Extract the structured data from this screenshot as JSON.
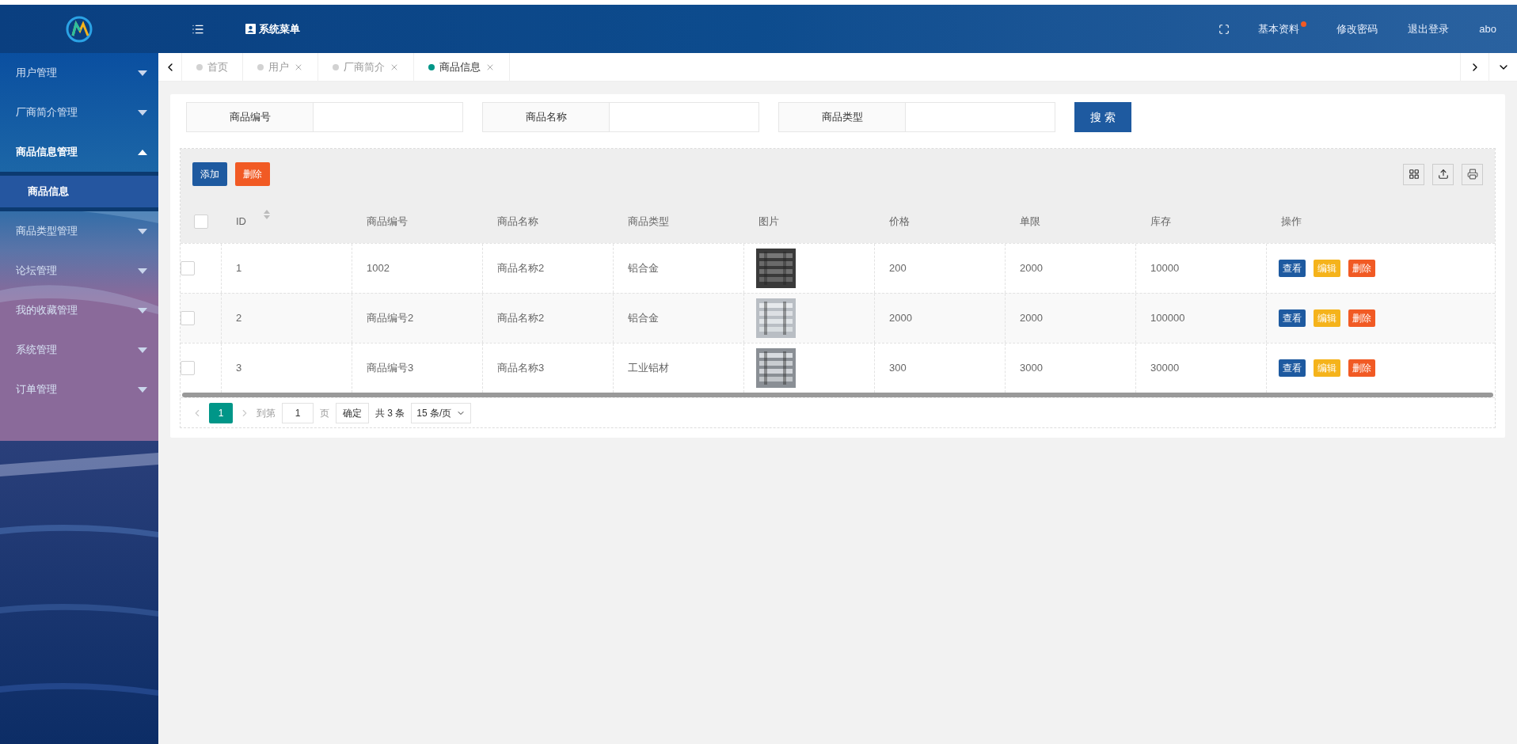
{
  "header": {
    "menu_label": "系统菜单",
    "links": [
      {
        "label": "基本资料",
        "dot": true
      },
      {
        "label": "修改密码",
        "dot": false
      },
      {
        "label": "退出登录",
        "dot": false
      },
      {
        "label": "abo",
        "dot": false
      }
    ]
  },
  "sidebar": {
    "items": [
      {
        "label": "用户管理",
        "expanded": false
      },
      {
        "label": "厂商简介管理",
        "expanded": false
      },
      {
        "label": "商品信息管理",
        "expanded": true,
        "children": [
          {
            "label": "商品信息",
            "selected": true
          }
        ]
      },
      {
        "label": "商品类型管理",
        "expanded": false
      },
      {
        "label": "论坛管理",
        "expanded": false
      },
      {
        "label": "我的收藏管理",
        "expanded": false
      },
      {
        "label": "系统管理",
        "expanded": false
      },
      {
        "label": "订单管理",
        "expanded": false
      }
    ]
  },
  "tabs": [
    {
      "label": "首页",
      "selected": false,
      "closable": false
    },
    {
      "label": "用户",
      "selected": false,
      "closable": true
    },
    {
      "label": "厂商简介",
      "selected": false,
      "closable": true
    },
    {
      "label": "商品信息",
      "selected": true,
      "closable": true
    }
  ],
  "search": {
    "fields": [
      {
        "label": "商品编号"
      },
      {
        "label": "商品名称"
      },
      {
        "label": "商品类型"
      }
    ],
    "button": "搜 索"
  },
  "toolbar": {
    "add": "添加",
    "delete": "删除"
  },
  "table": {
    "all_checked": false,
    "columns": [
      "ID",
      "商品编号",
      "商品名称",
      "商品类型",
      "图片",
      "价格",
      "单限",
      "库存",
      "操作"
    ],
    "rows": [
      {
        "checked": false,
        "cells": [
          "1",
          "1002",
          "商品名称2",
          "铝合金"
        ],
        "image": {
          "kind": "picture"
        },
        "after": [
          "200",
          "2000",
          "10000"
        ],
        "actions": [
          "查看",
          "编辑",
          "删除"
        ]
      },
      {
        "checked": false,
        "cells": [
          "2",
          "商品编号2",
          "商品名称2",
          "铝合金"
        ],
        "image": {
          "kind": "picture"
        },
        "after": [
          "2000",
          "2000",
          "100000"
        ],
        "actions": [
          "查看",
          "编辑",
          "删除"
        ]
      },
      {
        "checked": false,
        "cells": [
          "3",
          "商品编号3",
          "商品名称3",
          "工业铝材"
        ],
        "image": {
          "kind": "picture"
        },
        "after": [
          "300",
          "3000",
          "30000"
        ],
        "actions": [
          "查看",
          "编辑",
          "删除"
        ]
      }
    ]
  },
  "pagination": {
    "current": "1",
    "goto": "到第",
    "page_input": "1",
    "page_unit": "页",
    "confirm": "确定",
    "total": "共 3 条",
    "page_size": "15 条/页"
  }
}
